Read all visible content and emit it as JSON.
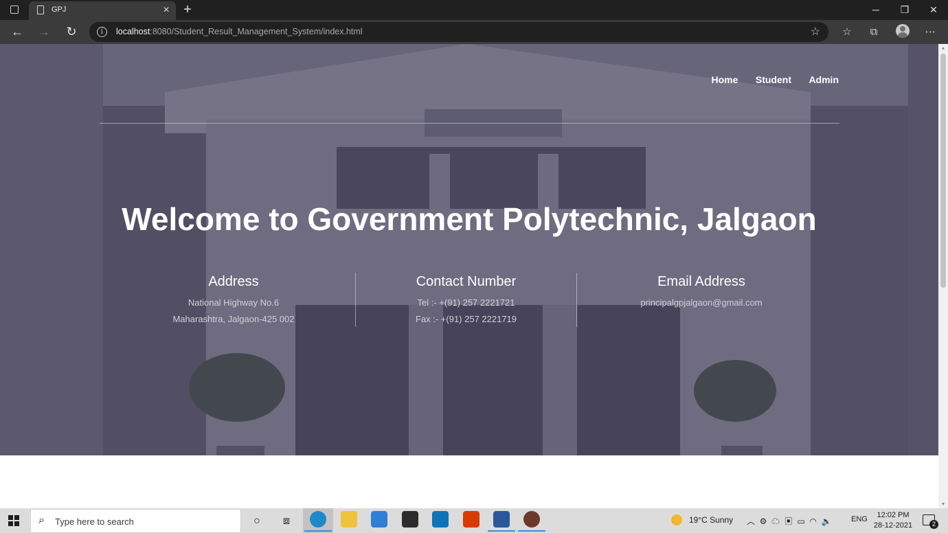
{
  "browser": {
    "tab_title": "GPJ",
    "url_host": "localhost",
    "url_rest": ":8080/Student_Result_Management_System/index.html"
  },
  "page": {
    "nav": [
      "Home",
      "Student",
      "Admin"
    ],
    "welcome": "Welcome to Government Polytechnic, Jalgaon",
    "address": {
      "heading": "Address",
      "line1": "National Highway No.6",
      "line2": "Maharashtra, Jalgaon-425 002"
    },
    "contact": {
      "heading": "Contact Number",
      "line1": "Tel :- +(91) 257 2221721",
      "line2": "Fax :- +(91) 257 2221719"
    },
    "email": {
      "heading": "Email Address",
      "line1": "principalgpjalgaon@gmail.com"
    }
  },
  "taskbar": {
    "search_placeholder": "Type here to search",
    "weather": "19°C  Sunny",
    "language": "ENG",
    "time": "12:02 PM",
    "date": "28-12-2021",
    "notification_count": "2"
  }
}
